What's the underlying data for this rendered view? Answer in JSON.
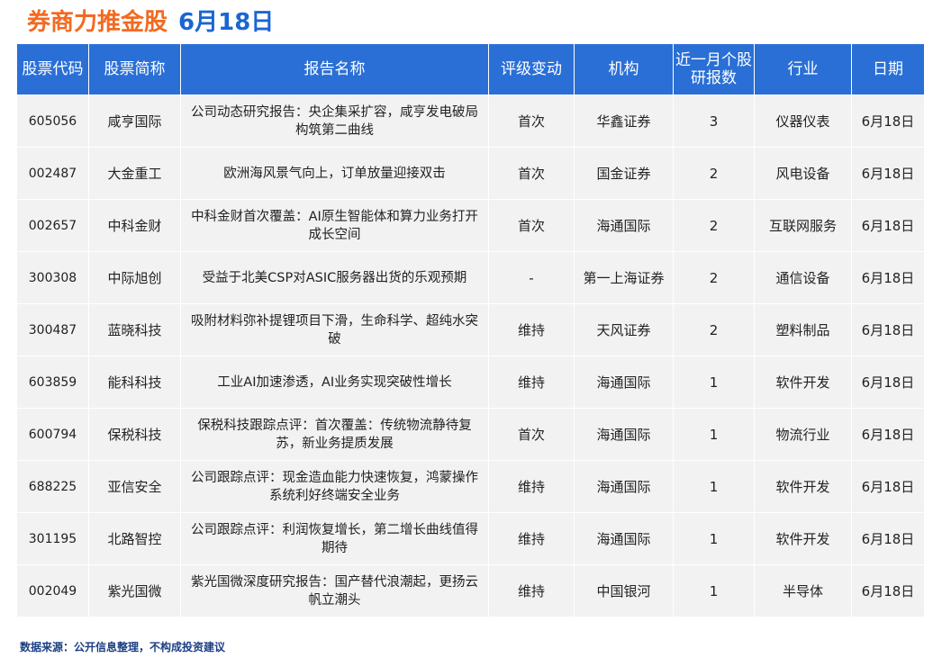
{
  "title": {
    "main": "券商力推金股",
    "date": "6月18日"
  },
  "table": {
    "headers": [
      "股票代码",
      "股票简称",
      "报告名称",
      "评级变动",
      "机构",
      "近一月个股研报数",
      "行业",
      "日期"
    ],
    "rows": [
      [
        "605056",
        "咸亨国际",
        "公司动态研究报告：央企集采扩容，咸亨发电破局构筑第二曲线",
        "首次",
        "华鑫证券",
        "3",
        "仪器仪表",
        "6月18日"
      ],
      [
        "002487",
        "大金重工",
        "欧洲海风景气向上，订单放量迎接双击",
        "首次",
        "国金证券",
        "2",
        "风电设备",
        "6月18日"
      ],
      [
        "002657",
        "中科金财",
        "中科金财首次覆盖：AI原生智能体和算力业务打开成长空间",
        "首次",
        "海通国际",
        "2",
        "互联网服务",
        "6月18日"
      ],
      [
        "300308",
        "中际旭创",
        "受益于北美CSP对ASIC服务器出货的乐观预期",
        "-",
        "第一上海证券",
        "2",
        "通信设备",
        "6月18日"
      ],
      [
        "300487",
        "蓝晓科技",
        "吸附材料弥补提锂项目下滑，生命科学、超纯水突破",
        "维持",
        "天风证券",
        "2",
        "塑料制品",
        "6月18日"
      ],
      [
        "603859",
        "能科科技",
        "工业AI加速渗透，AI业务实现突破性增长",
        "维持",
        "海通国际",
        "1",
        "软件开发",
        "6月18日"
      ],
      [
        "600794",
        "保税科技",
        "保税科技跟踪点评：首次覆盖：传统物流静待复苏，新业务提质发展",
        "首次",
        "海通国际",
        "1",
        "物流行业",
        "6月18日"
      ],
      [
        "688225",
        "亚信安全",
        "公司跟踪点评：现金造血能力快速恢复，鸿蒙操作系统利好终端安全业务",
        "维持",
        "海通国际",
        "1",
        "软件开发",
        "6月18日"
      ],
      [
        "301195",
        "北路智控",
        "公司跟踪点评：利润恢复增长，第二增长曲线值得期待",
        "维持",
        "海通国际",
        "1",
        "软件开发",
        "6月18日"
      ],
      [
        "002049",
        "紫光国微",
        "紫光国微深度研究报告：国产替代浪潮起，更扬云帆立潮头",
        "维持",
        "中国银河",
        "1",
        "半导体",
        "6月18日"
      ]
    ]
  },
  "footer": "数据来源：公开信息整理，不构成投资建议"
}
